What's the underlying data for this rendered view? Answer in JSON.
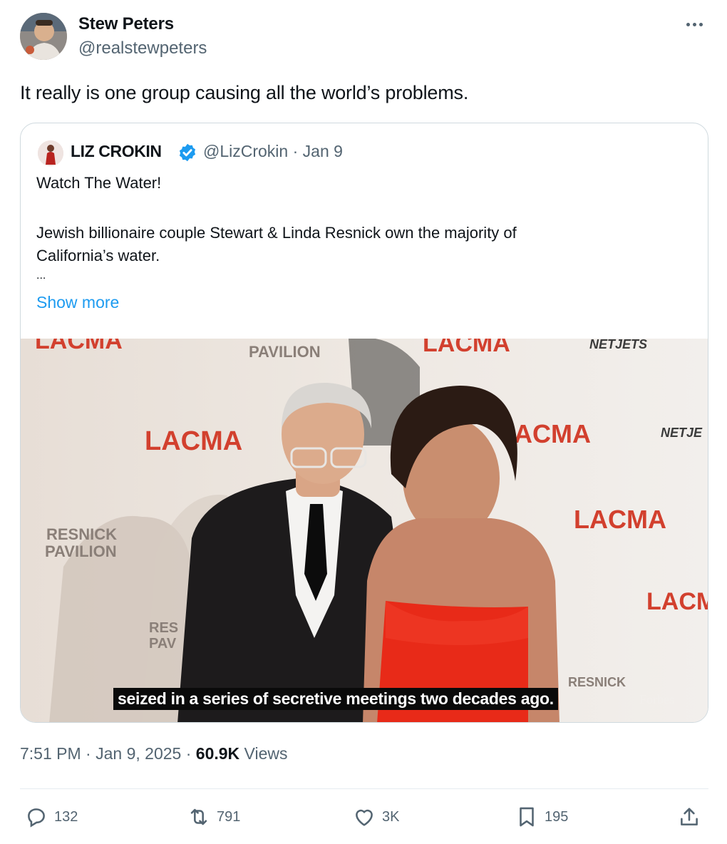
{
  "author": {
    "display_name": "Stew Peters",
    "handle": "@realstewpeters"
  },
  "tweet": {
    "text": "It really is one group causing all the world’s problems."
  },
  "quoted": {
    "display_name": "LIZ CROKIN",
    "handle": "@LizCrokin",
    "separator": "·",
    "date": "Jan 9",
    "lines": [
      "Watch The Water!",
      "Jewish billionaire couple Stewart & Linda Resnick own the majority of",
      "California’s water.",
      "..."
    ],
    "show_more": "Show more",
    "media": {
      "caption": "seized in a series of secretive meetings two decades ago.",
      "backdrop_texts": [
        "LACMA",
        "PAVILION",
        "LACMA",
        "NETJETS",
        "LACMA",
        "ACMA",
        "NETJE",
        "LACMA",
        "RESNICK",
        "PAVILION",
        "LACMA",
        "RES",
        "PAV",
        "RESNICK"
      ]
    }
  },
  "meta": {
    "time": "7:51 PM",
    "dot": "·",
    "date": "Jan 9, 2025",
    "views_count": "60.9K",
    "views_label": "Views"
  },
  "actions": {
    "replies": "132",
    "reposts": "791",
    "likes": "3K",
    "bookmarks": "195"
  },
  "icons": [
    "more-icon",
    "verified-badge-icon",
    "reply-icon",
    "repost-icon",
    "like-icon",
    "bookmark-icon",
    "share-icon"
  ],
  "colors": {
    "link": "#1d9bf0",
    "secondary_text": "#536471",
    "border": "#cfd9de",
    "verified": "#1d9bf0",
    "backdrop_logo": "#d2402e"
  }
}
